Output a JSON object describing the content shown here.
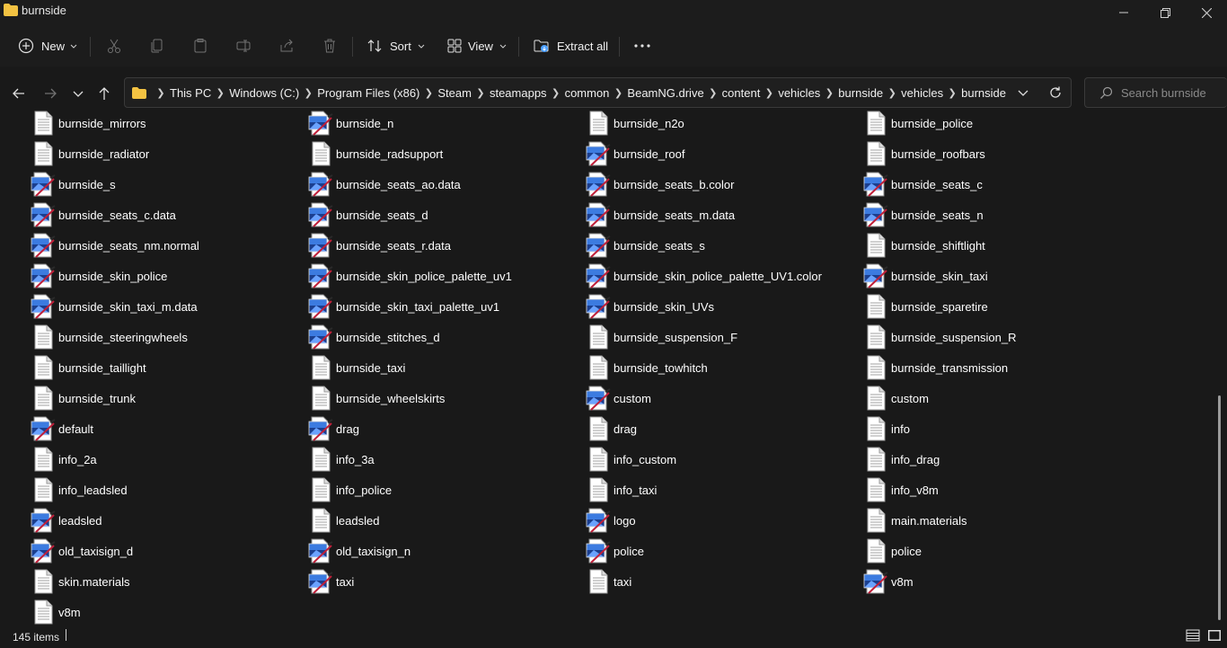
{
  "window": {
    "title": "burnside"
  },
  "toolbar": {
    "new_label": "New",
    "sort_label": "Sort",
    "view_label": "View",
    "extract_label": "Extract all"
  },
  "address": {
    "crumbs": [
      "This PC",
      "Windows (C:)",
      "Program Files (x86)",
      "Steam",
      "steamapps",
      "common",
      "BeamNG.drive",
      "content",
      "vehicles",
      "burnside",
      "vehicles",
      "burnside"
    ]
  },
  "search": {
    "placeholder": "Search burnside"
  },
  "files": [
    {
      "name": "burnside_mirrors",
      "icon": "document-icon"
    },
    {
      "name": "burnside_n",
      "icon": "image-icon"
    },
    {
      "name": "burnside_n2o",
      "icon": "document-icon"
    },
    {
      "name": "burnside_police",
      "icon": "document-icon"
    },
    {
      "name": "burnside_radiator",
      "icon": "document-icon"
    },
    {
      "name": "burnside_radsupport",
      "icon": "document-icon"
    },
    {
      "name": "burnside_roof",
      "icon": "image-icon"
    },
    {
      "name": "burnside_roofbars",
      "icon": "document-icon"
    },
    {
      "name": "burnside_s",
      "icon": "image-icon"
    },
    {
      "name": "burnside_seats_ao.data",
      "icon": "image-icon"
    },
    {
      "name": "burnside_seats_b.color",
      "icon": "image-icon"
    },
    {
      "name": "burnside_seats_c",
      "icon": "image-icon"
    },
    {
      "name": "burnside_seats_c.data",
      "icon": "image-icon"
    },
    {
      "name": "burnside_seats_d",
      "icon": "image-icon"
    },
    {
      "name": "burnside_seats_m.data",
      "icon": "image-icon"
    },
    {
      "name": "burnside_seats_n",
      "icon": "image-icon"
    },
    {
      "name": "burnside_seats_nm.normal",
      "icon": "image-icon"
    },
    {
      "name": "burnside_seats_r.data",
      "icon": "image-icon"
    },
    {
      "name": "burnside_seats_s",
      "icon": "image-icon"
    },
    {
      "name": "burnside_shiftlight",
      "icon": "document-icon"
    },
    {
      "name": "burnside_skin_police",
      "icon": "image-icon"
    },
    {
      "name": "burnside_skin_police_palette_uv1",
      "icon": "image-icon"
    },
    {
      "name": "burnside_skin_police_palette_UV1.color",
      "icon": "image-icon"
    },
    {
      "name": "burnside_skin_taxi",
      "icon": "image-icon"
    },
    {
      "name": "burnside_skin_taxi_m.data",
      "icon": "image-icon"
    },
    {
      "name": "burnside_skin_taxi_palette_uv1",
      "icon": "image-icon"
    },
    {
      "name": "burnside_skin_UVs",
      "icon": "image-icon"
    },
    {
      "name": "burnside_sparetire",
      "icon": "document-icon"
    },
    {
      "name": "burnside_steeringwheels",
      "icon": "document-icon"
    },
    {
      "name": "burnside_stitches_d",
      "icon": "image-icon"
    },
    {
      "name": "burnside_suspension_F",
      "icon": "document-icon"
    },
    {
      "name": "burnside_suspension_R",
      "icon": "document-icon"
    },
    {
      "name": "burnside_taillight",
      "icon": "document-icon"
    },
    {
      "name": "burnside_taxi",
      "icon": "document-icon"
    },
    {
      "name": "burnside_towhitch",
      "icon": "document-icon"
    },
    {
      "name": "burnside_transmission",
      "icon": "document-icon"
    },
    {
      "name": "burnside_trunk",
      "icon": "document-icon"
    },
    {
      "name": "burnside_wheelskirts",
      "icon": "document-icon"
    },
    {
      "name": "custom",
      "icon": "image-icon"
    },
    {
      "name": "custom",
      "icon": "document-icon"
    },
    {
      "name": "default",
      "icon": "image-icon"
    },
    {
      "name": "drag",
      "icon": "image-icon"
    },
    {
      "name": "drag",
      "icon": "document-icon"
    },
    {
      "name": "info",
      "icon": "document-icon"
    },
    {
      "name": "info_2a",
      "icon": "document-icon"
    },
    {
      "name": "info_3a",
      "icon": "document-icon"
    },
    {
      "name": "info_custom",
      "icon": "document-icon"
    },
    {
      "name": "info_drag",
      "icon": "document-icon"
    },
    {
      "name": "info_leadsled",
      "icon": "document-icon"
    },
    {
      "name": "info_police",
      "icon": "document-icon"
    },
    {
      "name": "info_taxi",
      "icon": "document-icon"
    },
    {
      "name": "info_v8m",
      "icon": "document-icon"
    },
    {
      "name": "leadsled",
      "icon": "image-icon"
    },
    {
      "name": "leadsled",
      "icon": "document-icon"
    },
    {
      "name": "logo",
      "icon": "image-icon"
    },
    {
      "name": "main.materials",
      "icon": "document-icon"
    },
    {
      "name": "old_taxisign_d",
      "icon": "image-icon"
    },
    {
      "name": "old_taxisign_n",
      "icon": "image-icon"
    },
    {
      "name": "police",
      "icon": "image-icon"
    },
    {
      "name": "police",
      "icon": "document-icon"
    },
    {
      "name": "skin.materials",
      "icon": "document-icon"
    },
    {
      "name": "taxi",
      "icon": "image-icon"
    },
    {
      "name": "taxi",
      "icon": "document-icon"
    },
    {
      "name": "v8m",
      "icon": "image-icon"
    },
    {
      "name": "v8m",
      "icon": "document-icon"
    }
  ],
  "status": {
    "item_count": "145 items"
  },
  "colors": {
    "background": "#191919",
    "chrome": "#1c1c1c",
    "accent": "#4ca0ff",
    "folder": "#f3c242"
  }
}
